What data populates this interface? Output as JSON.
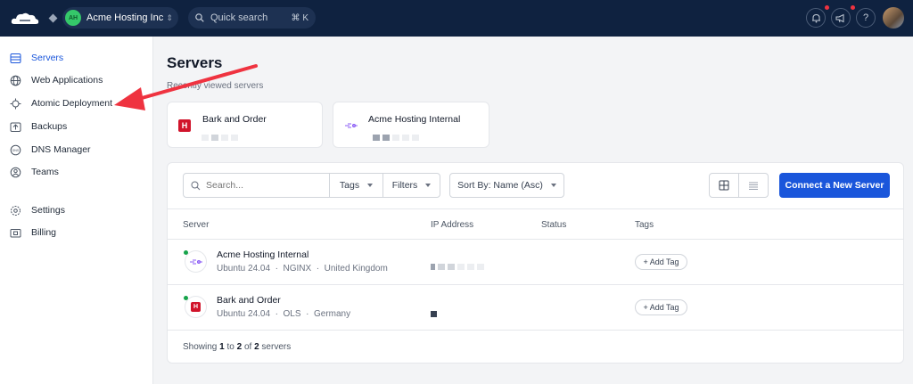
{
  "header": {
    "org_initials": "AH",
    "org_name": "Acme Hosting Inc",
    "quick_search": "Quick search",
    "quick_search_kbd": "⌘ K"
  },
  "sidebar": {
    "items": [
      {
        "label": "Servers",
        "icon": "server-icon",
        "active": true
      },
      {
        "label": "Web Applications",
        "icon": "globe-icon"
      },
      {
        "label": "Atomic Deployment",
        "icon": "atom-icon"
      },
      {
        "label": "Backups",
        "icon": "backup-icon"
      },
      {
        "label": "DNS Manager",
        "icon": "dns-icon"
      },
      {
        "label": "Teams",
        "icon": "team-icon"
      },
      {
        "label": "Settings",
        "icon": "gear-icon"
      },
      {
        "label": "Billing",
        "icon": "billing-icon"
      }
    ]
  },
  "main": {
    "title": "Servers",
    "recent_label": "Recently viewed servers",
    "recent": [
      {
        "name": "Bark and Order",
        "icon": "H"
      },
      {
        "name": "Acme Hosting Internal",
        "icon": "acme-logo"
      }
    ],
    "toolbar": {
      "search_placeholder": "Search...",
      "tags_label": "Tags",
      "filters_label": "Filters",
      "sort_label": "Sort By: Name (Asc)",
      "connect_label": "Connect a New Server"
    },
    "table": {
      "headers": [
        "Server",
        "IP Address",
        "Status",
        "Tags"
      ],
      "rows": [
        {
          "name": "Acme Hosting Internal",
          "os": "Ubuntu 24.04",
          "stack": "NGINX",
          "location": "United Kingdom",
          "add_tag": "+ Add Tag"
        },
        {
          "name": "Bark and Order",
          "os": "Ubuntu 24.04",
          "stack": "OLS",
          "location": "Germany",
          "add_tag": "+ Add Tag"
        }
      ]
    },
    "footer": {
      "prefix": "Showing",
      "from": "1",
      "to_word": "to",
      "to": "2",
      "of_word": "of",
      "total": "2",
      "suffix": "servers"
    }
  },
  "colors": {
    "accent": "#1a56db",
    "topbar": "#0f2240",
    "brand_red": "#d1142b",
    "annotation": "#ef3340"
  }
}
